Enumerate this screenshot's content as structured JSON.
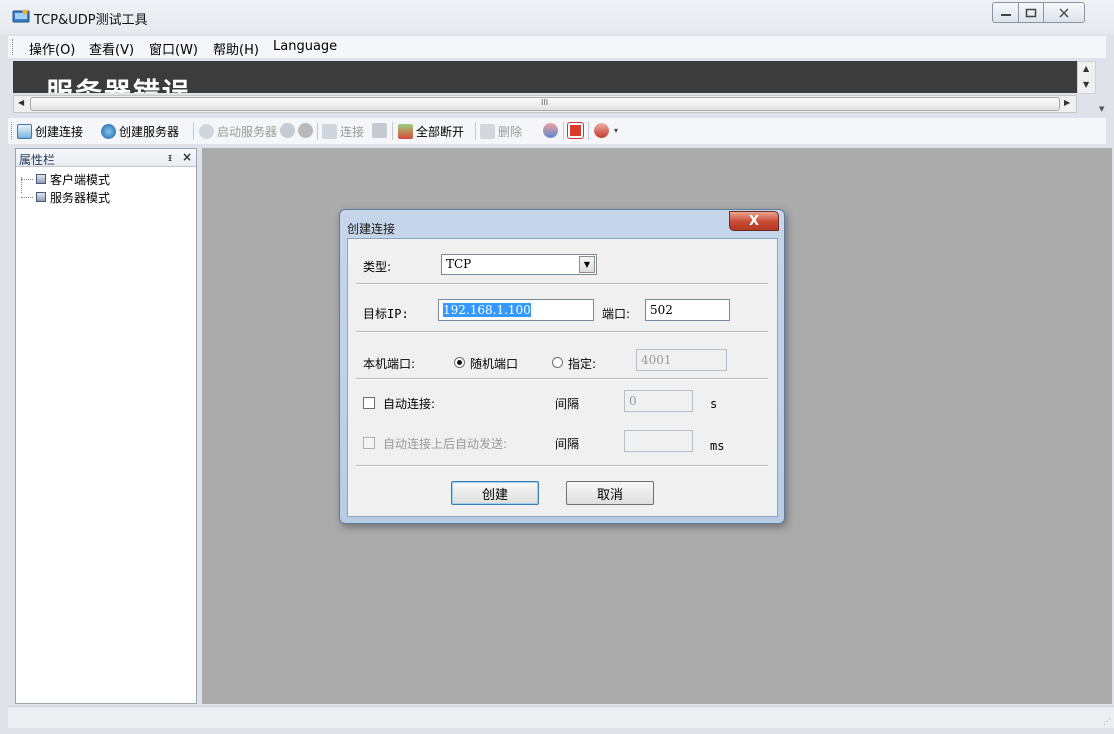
{
  "window": {
    "title": "TCP&UDP测试工具",
    "min_icon": "minimize-icon",
    "max_icon": "maximize-icon",
    "close_icon": "close-icon"
  },
  "menu": {
    "items": [
      "操作(O)",
      "查看(V)",
      "窗口(W)",
      "帮助(H)",
      "Language"
    ]
  },
  "banner": {
    "text": "服务器错误"
  },
  "scrollbar": {
    "thumb_grip": "III"
  },
  "toolbar": {
    "create_connection": "创建连接",
    "create_server": "创建服务器",
    "start_server": "启动服务器",
    "connect": "连接",
    "disconnect_all": "全部断开",
    "delete": "删除"
  },
  "property_panel": {
    "title": "属性栏",
    "pin": "ᵻ",
    "close": "×",
    "tree": [
      "客户端模式",
      "服务器模式"
    ]
  },
  "dialog": {
    "title": "创建连接",
    "close_label": "X",
    "type_label": "类型:",
    "type_value": "TCP",
    "target_ip_label": "目标IP:",
    "target_ip_value": "192.168.1.100",
    "port_label": "端口:",
    "port_value": "502",
    "local_port_label": "本机端口:",
    "random_port_label": "随机端口",
    "random_port_selected": true,
    "specify_label": "指定:",
    "specify_value": "4001",
    "auto_connect_label": "自动连接:",
    "auto_connect_checked": false,
    "interval_label_1": "间隔",
    "interval_value_1": "0",
    "interval_unit_1": "s",
    "auto_send_label": "自动连接上后自动发送:",
    "auto_send_checked": false,
    "interval_label_2": "间隔",
    "interval_value_2": "",
    "interval_unit_2": "ms",
    "create_button": "创建",
    "cancel_button": "取消"
  },
  "colors": {
    "mdi_background": "#ababab",
    "banner_background": "#3c3c3c",
    "dialog_frame": "#b7cce4",
    "close_button": "#c84a32",
    "selection": "#3399ff"
  }
}
